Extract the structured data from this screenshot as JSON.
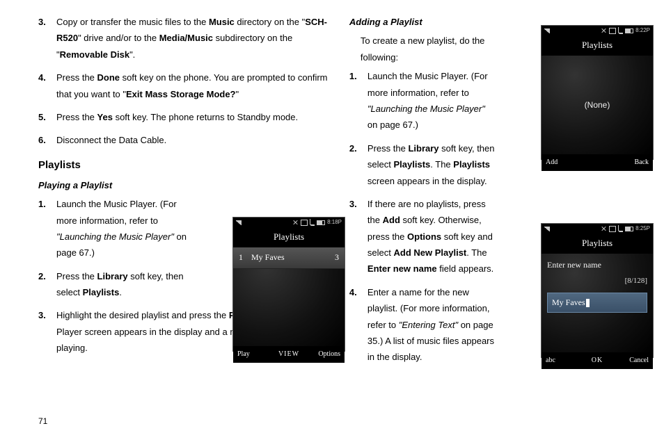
{
  "left": {
    "step3": {
      "pre": "Copy or transfer the music files to the ",
      "music": "Music",
      "mid1": " directory on the \"",
      "drive": "SCH-R520",
      "mid2": "\" drive and/or to the ",
      "mediaMusic": "Media/Music",
      "mid3": " subdirectory on the \"",
      "removable": "Removable Disk",
      "post": "\"."
    },
    "step4": {
      "pre": "Press the ",
      "done": "Done",
      "mid1": " soft key on the phone. You are prompted to confirm that you want to \"",
      "exit": "Exit Mass Storage Mode?",
      "post": "\""
    },
    "step5": {
      "pre": "Press the ",
      "yes": "Yes",
      "post": " soft key. The phone returns to Standby mode."
    },
    "step6": "Disconnect the Data Cable.",
    "h_playlists": "Playlists",
    "h_playing": "Playing a Playlist",
    "p1_step1": {
      "pre": "Launch the Music Player. (For more information, refer to ",
      "ref": "\"Launching the Music Player\"",
      "post": " on page 67.)"
    },
    "p1_step2": {
      "pre": "Press the ",
      "library": "Library",
      "mid": " soft key, then select ",
      "playlists": "Playlists",
      "post": "."
    },
    "p1_step3": {
      "pre": "Highlight the desired playlist and press the ",
      "play": "Play",
      "post": " soft key. The Music Player screen appears in the display and a music file begins playing."
    }
  },
  "right": {
    "h_adding": "Adding a Playlist",
    "intro": "To create a new playlist, do the following:",
    "a_step1": {
      "pre": "Launch the Music Player. (For more information, refer to ",
      "ref": "\"Launching the Music Player\"",
      "post": " on page 67.)"
    },
    "a_step2": {
      "pre": "Press the ",
      "library": "Library",
      "mid1": " soft key, then select ",
      "playlists": "Playlists",
      "mid2": ". The ",
      "playlists2": "Playlists",
      "post": " screen appears in the display."
    },
    "a_step3": {
      "pre": "If there are no playlists, press the ",
      "add": "Add",
      "mid1": " soft key. Otherwise, press the ",
      "options": "Options",
      "mid2": " soft key and select ",
      "addnew": "Add New Playlist",
      "mid3": ". The ",
      "entername": "Enter new name",
      "post": " field appears."
    },
    "a_step4": {
      "pre": "Enter a name for the new playlist. (For more information, refer to ",
      "ref": "\"Entering Text\"",
      "post": "  on page 35.) A list of music files appears in the display."
    }
  },
  "phone1": {
    "time": "8:18P",
    "title": "Playlists",
    "row_num": "1",
    "row_label": "My Faves",
    "row_count": "3",
    "sk_left": "Play",
    "sk_center": "VIEW",
    "sk_right": "Options"
  },
  "phone2": {
    "time": "8:22P",
    "title": "Playlists",
    "none": "(None)",
    "sk_left": "Add",
    "sk_center": "",
    "sk_right": "Back"
  },
  "phone3": {
    "time": "8:25P",
    "title": "Playlists",
    "enter_label": "Enter new name",
    "counter": "[8/128]",
    "input_value": "My Faves",
    "sk_left": "abc",
    "sk_center": "OK",
    "sk_right": "Cancel"
  },
  "nums": {
    "n3": "3.",
    "n4": "4.",
    "n5": "5.",
    "n6": "6.",
    "n1": "1.",
    "n2": "2."
  },
  "pagenum": "71"
}
